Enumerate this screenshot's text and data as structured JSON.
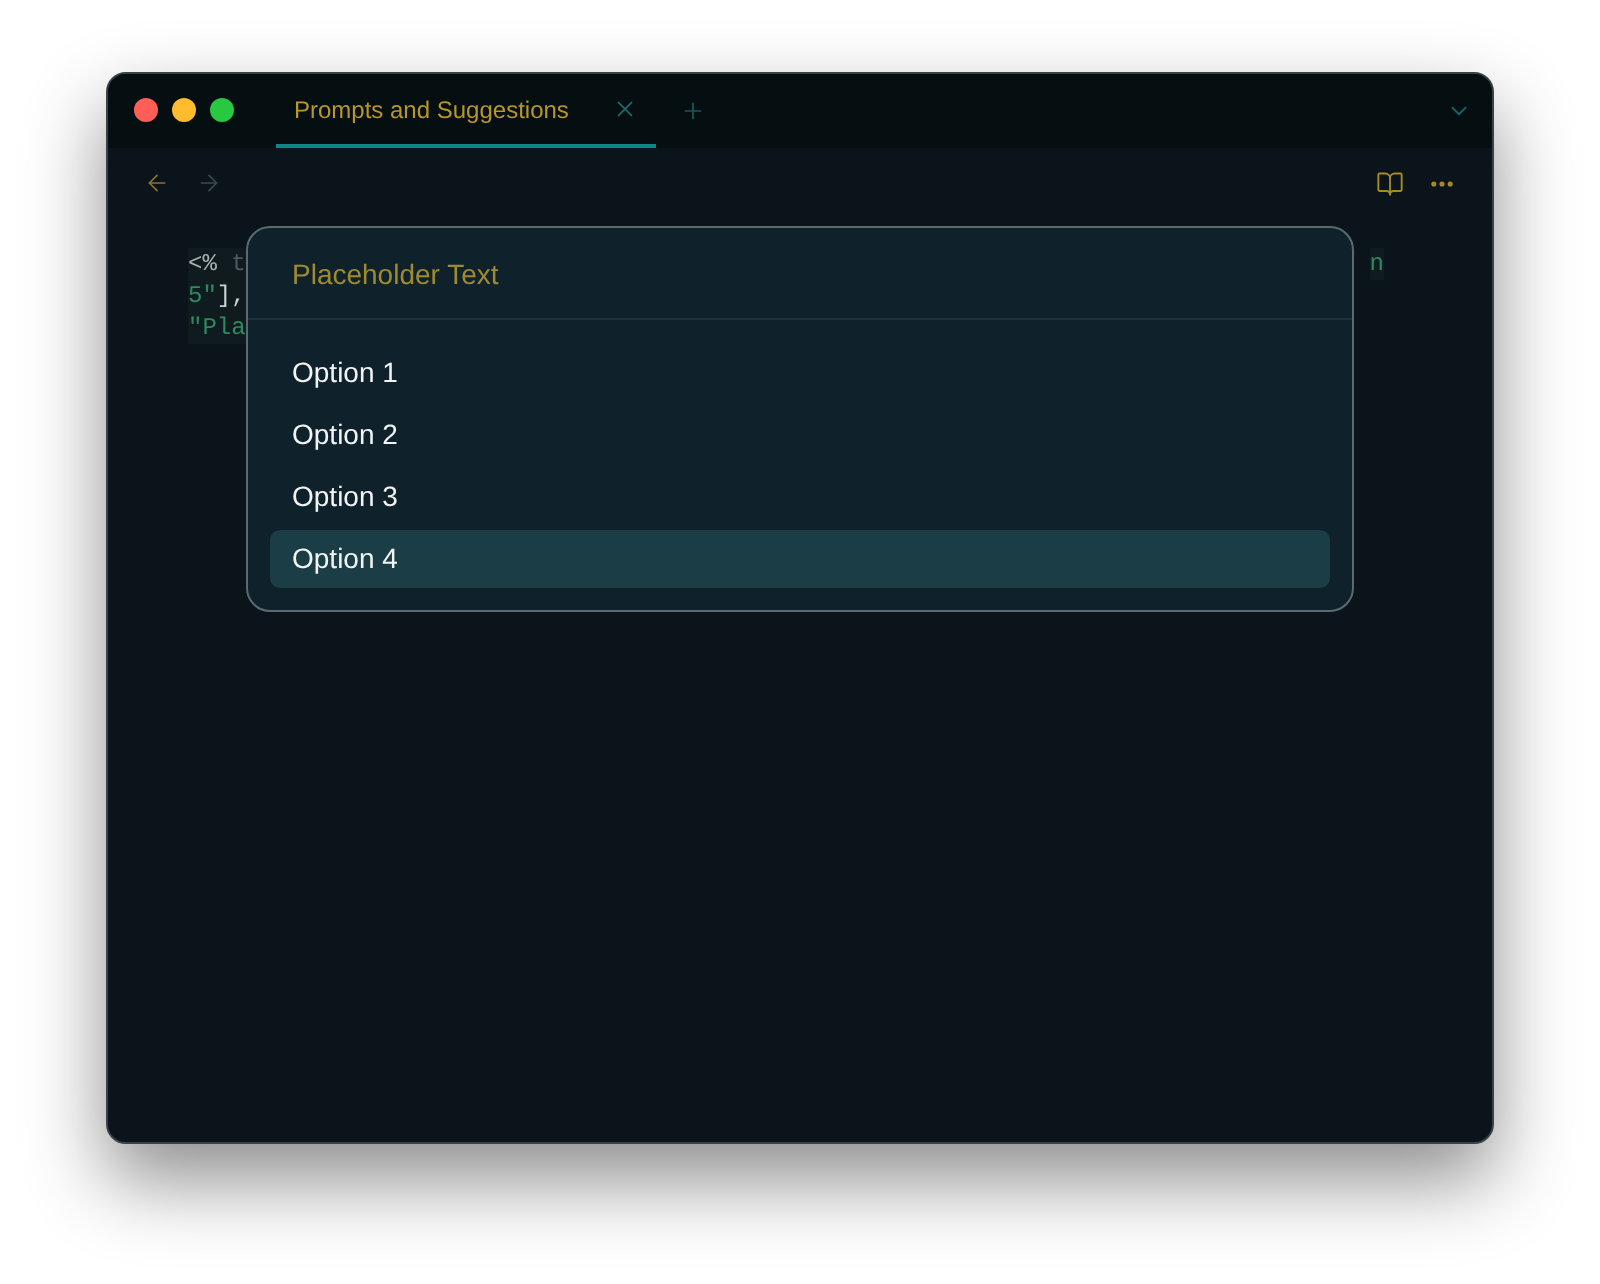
{
  "tabs": [
    {
      "label": "Prompts and Suggestions",
      "selected": true
    }
  ],
  "code_lines": [
    {
      "start": [
        {
          "text": "<%",
          "kind": "tag"
        },
        {
          "text": " t",
          "kind": "dim"
        }
      ],
      "end": [
        {
          "text": "n",
          "kind": "string"
        }
      ]
    },
    {
      "start": [
        {
          "text": "5\"",
          "kind": "string"
        },
        {
          "text": "],",
          "kind": "punct"
        }
      ]
    },
    {
      "start": [
        {
          "text": "\"Pla",
          "kind": "string"
        }
      ]
    }
  ],
  "popup": {
    "search": {
      "placeholder": "Placeholder Text"
    },
    "options": [
      {
        "label": "Option 1",
        "selected": false
      },
      {
        "label": "Option 2",
        "selected": false
      },
      {
        "label": "Option 3",
        "selected": false
      },
      {
        "label": "Option 4",
        "selected": true
      }
    ]
  }
}
